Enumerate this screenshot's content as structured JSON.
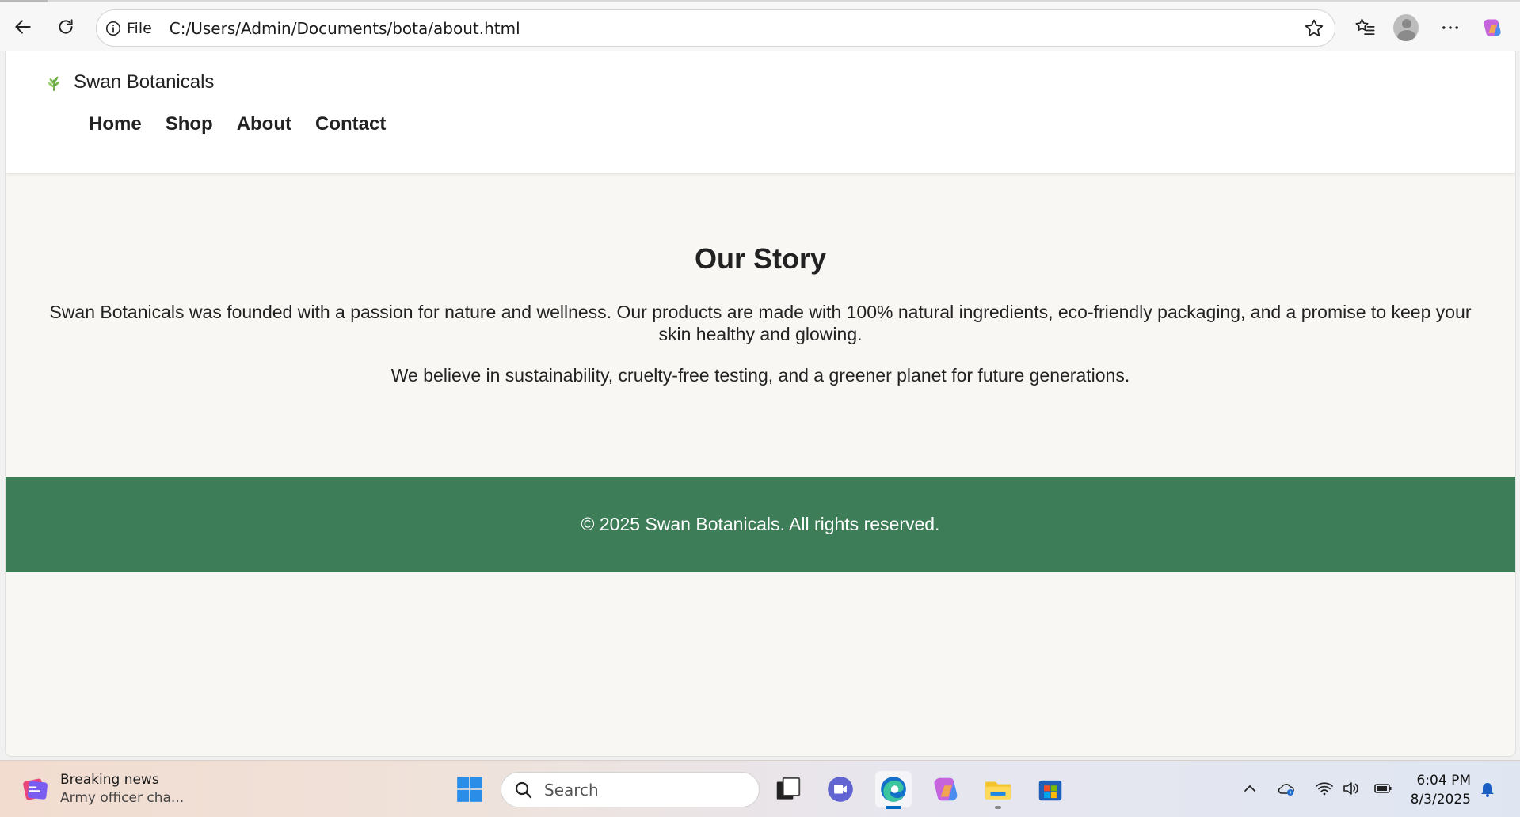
{
  "browser": {
    "file_label": "File",
    "url": "C:/Users/Admin/Documents/bota/about.html"
  },
  "site": {
    "brand": "Swan Botanicals",
    "nav": [
      "Home",
      "Shop",
      "About",
      "Contact"
    ],
    "heading": "Our Story",
    "paragraph1": "Swan Botanicals was founded with a passion for nature and wellness. Our products are made with 100% natural ingredients, eco-friendly packaging, and a promise to keep your skin healthy and glowing.",
    "paragraph2": "We believe in sustainability, cruelty-free testing, and a greener planet for future generations.",
    "footer": "© 2025 Swan Botanicals. All rights reserved.",
    "colors": {
      "footer_bg": "#3d7d57",
      "page_bg": "#f8f7f3"
    }
  },
  "taskbar": {
    "news_title": "Breaking news",
    "news_subtitle": "Army officer cha...",
    "search_placeholder": "Search",
    "time": "6:04 PM",
    "date": "8/3/2025"
  }
}
